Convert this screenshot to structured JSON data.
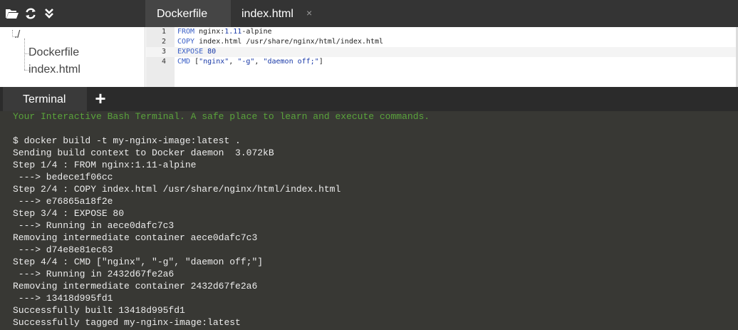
{
  "toolbar": {
    "icons": [
      "folder-open-icon",
      "refresh-icon",
      "collapse-chevrons-icon"
    ]
  },
  "editor_tabs": [
    {
      "label": "Dockerfile",
      "active": true
    },
    {
      "label": "index.html",
      "active": false,
      "close_label": "×"
    }
  ],
  "file_tree": {
    "root": "./",
    "files": [
      "Dockerfile",
      "index.html"
    ]
  },
  "editor": {
    "lines": [
      {
        "num": "1",
        "tokens": [
          {
            "t": "FROM",
            "c": "kw"
          },
          {
            "t": " nginx:",
            "c": ""
          },
          {
            "t": "1.11",
            "c": "num"
          },
          {
            "t": "-alpine",
            "c": ""
          }
        ]
      },
      {
        "num": "2",
        "tokens": [
          {
            "t": "COPY",
            "c": "kw"
          },
          {
            "t": " index.html /usr/share/nginx/html/index.html",
            "c": ""
          }
        ]
      },
      {
        "num": "3",
        "tokens": [
          {
            "t": "EXPOSE",
            "c": "kw"
          },
          {
            "t": " ",
            "c": ""
          },
          {
            "t": "80",
            "c": "num"
          }
        ]
      },
      {
        "num": "4",
        "tokens": [
          {
            "t": "CMD",
            "c": "kw"
          },
          {
            "t": " [",
            "c": ""
          },
          {
            "t": "\"nginx\"",
            "c": "str"
          },
          {
            "t": ", ",
            "c": ""
          },
          {
            "t": "\"-g\"",
            "c": "str"
          },
          {
            "t": ", ",
            "c": ""
          },
          {
            "t": "\"daemon off;\"",
            "c": "str"
          },
          {
            "t": "]",
            "c": ""
          }
        ]
      }
    ]
  },
  "terminal": {
    "tab_label": "Terminal",
    "add_label": "+",
    "banner": "Your Interactive Bash Terminal. A safe place to learn and execute commands.",
    "lines": [
      "$ docker build -t my-nginx-image:latest .",
      "Sending build context to Docker daemon  3.072kB",
      "Step 1/4 : FROM nginx:1.11-alpine",
      " ---> bedece1f06cc",
      "Step 2/4 : COPY index.html /usr/share/nginx/html/index.html",
      " ---> e76865a18f2e",
      "Step 3/4 : EXPOSE 80",
      " ---> Running in aece0dafc7c3",
      "Removing intermediate container aece0dafc7c3",
      " ---> d74e8e81ec63",
      "Step 4/4 : CMD [\"nginx\", \"-g\", \"daemon off;\"]",
      " ---> Running in 2432d67fe2a6",
      "Removing intermediate container 2432d67fe2a6",
      " ---> 13418d995fd1",
      "Successfully built 13418d995fd1",
      "Successfully tagged my-nginx-image:latest"
    ]
  },
  "colors": {
    "toolbar_bg": "#343434",
    "terminal_bg": "#383834",
    "banner_green": "#5aa33c",
    "keyword_blue": "#3a5fc7"
  }
}
